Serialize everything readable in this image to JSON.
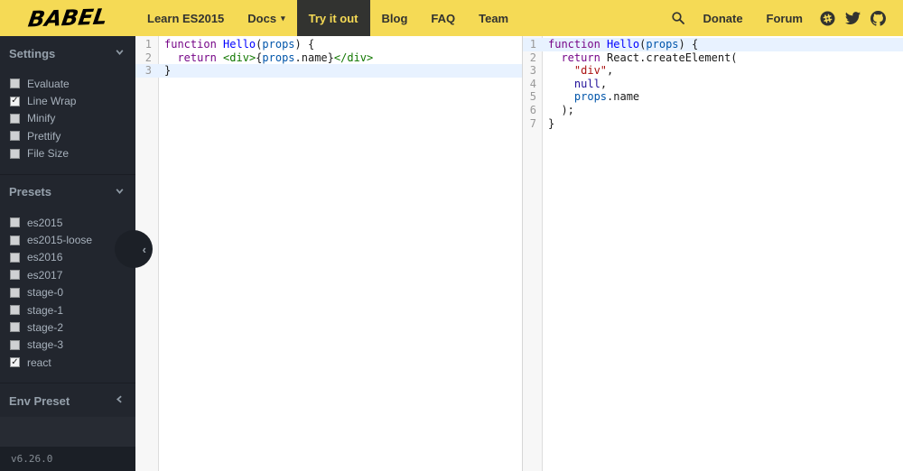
{
  "header": {
    "logo": "BABEL",
    "nav": [
      {
        "label": "Learn ES2015",
        "active": false,
        "caret": false
      },
      {
        "label": "Docs",
        "active": false,
        "caret": true
      },
      {
        "label": "Try it out",
        "active": true,
        "caret": false
      },
      {
        "label": "Blog",
        "active": false,
        "caret": false
      },
      {
        "label": "FAQ",
        "active": false,
        "caret": false
      },
      {
        "label": "Team",
        "active": false,
        "caret": false
      }
    ],
    "links": [
      {
        "label": "Donate"
      },
      {
        "label": "Forum"
      }
    ],
    "icons": [
      "search-icon",
      "slack-icon",
      "twitter-icon",
      "github-icon"
    ],
    "colors": {
      "background": "#f5da55",
      "text": "#323330",
      "active_bg": "#323330",
      "active_text": "#f5da55"
    }
  },
  "sidebar": {
    "sections": [
      {
        "title": "Settings",
        "chevron": "down",
        "items": [
          {
            "label": "Evaluate",
            "checked": false
          },
          {
            "label": "Line Wrap",
            "checked": true
          },
          {
            "label": "Minify",
            "checked": false
          },
          {
            "label": "Prettify",
            "checked": false
          },
          {
            "label": "File Size",
            "checked": false
          }
        ]
      },
      {
        "title": "Presets",
        "chevron": "down",
        "items": [
          {
            "label": "es2015",
            "checked": false
          },
          {
            "label": "es2015-loose",
            "checked": false
          },
          {
            "label": "es2016",
            "checked": false
          },
          {
            "label": "es2017",
            "checked": false
          },
          {
            "label": "stage-0",
            "checked": false
          },
          {
            "label": "stage-1",
            "checked": false
          },
          {
            "label": "stage-2",
            "checked": false
          },
          {
            "label": "stage-3",
            "checked": false
          },
          {
            "label": "react",
            "checked": true
          }
        ]
      },
      {
        "title": "Env Preset",
        "chevron": "left",
        "items": []
      }
    ],
    "version": "v6.26.0"
  },
  "editors": {
    "syntax_colors": {
      "keyword": "#708",
      "def": "#00f",
      "variable": "#05a",
      "tag": "#170",
      "string": "#a11",
      "atom": "#219",
      "plain": "#1b1b1b"
    },
    "highlight_color": "#e8f2ff",
    "source": {
      "highlight_line": 3,
      "lines": [
        [
          {
            "c": "keyword",
            "t": "function"
          },
          {
            "c": "plain",
            "t": " "
          },
          {
            "c": "def",
            "t": "Hello"
          },
          {
            "c": "plain",
            "t": "("
          },
          {
            "c": "variable",
            "t": "props"
          },
          {
            "c": "plain",
            "t": ") {"
          }
        ],
        [
          {
            "c": "plain",
            "t": "  "
          },
          {
            "c": "keyword",
            "t": "return"
          },
          {
            "c": "plain",
            "t": " "
          },
          {
            "c": "tag",
            "t": "<div>"
          },
          {
            "c": "plain",
            "t": "{"
          },
          {
            "c": "variable",
            "t": "props"
          },
          {
            "c": "plain",
            "t": ".name}"
          },
          {
            "c": "tag",
            "t": "</div>"
          }
        ],
        [
          {
            "c": "plain",
            "t": "}"
          }
        ]
      ]
    },
    "output": {
      "highlight_line": 1,
      "lines": [
        [
          {
            "c": "keyword",
            "t": "function"
          },
          {
            "c": "plain",
            "t": " "
          },
          {
            "c": "def",
            "t": "Hello"
          },
          {
            "c": "plain",
            "t": "("
          },
          {
            "c": "variable",
            "t": "props"
          },
          {
            "c": "plain",
            "t": ") {"
          }
        ],
        [
          {
            "c": "plain",
            "t": "  "
          },
          {
            "c": "keyword",
            "t": "return"
          },
          {
            "c": "plain",
            "t": " React.createElement("
          }
        ],
        [
          {
            "c": "plain",
            "t": "    "
          },
          {
            "c": "string",
            "t": "\"div\""
          },
          {
            "c": "plain",
            "t": ","
          }
        ],
        [
          {
            "c": "plain",
            "t": "    "
          },
          {
            "c": "atom",
            "t": "null"
          },
          {
            "c": "plain",
            "t": ","
          }
        ],
        [
          {
            "c": "plain",
            "t": "    "
          },
          {
            "c": "variable",
            "t": "props"
          },
          {
            "c": "plain",
            "t": ".name"
          }
        ],
        [
          {
            "c": "plain",
            "t": "  );"
          }
        ],
        [
          {
            "c": "plain",
            "t": "}"
          }
        ]
      ]
    }
  }
}
